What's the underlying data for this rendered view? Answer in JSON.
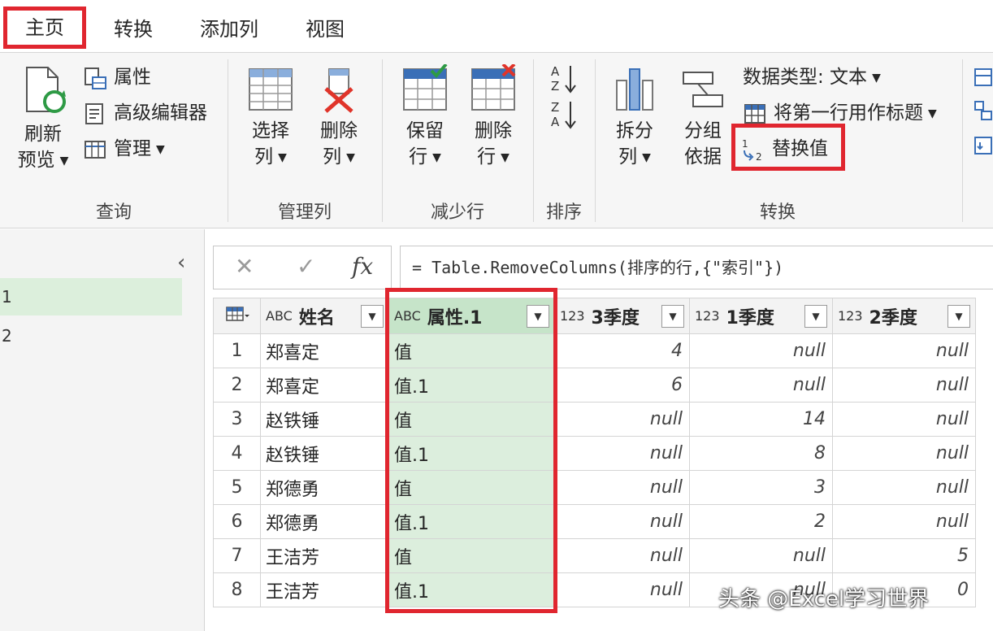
{
  "tabs": [
    "主页",
    "转换",
    "添加列",
    "视图"
  ],
  "ribbon": {
    "query": {
      "label": "查询",
      "refresh": [
        "刷新",
        "预览"
      ],
      "properties": "属性",
      "advanced_editor": "高级编辑器",
      "manage": "管理"
    },
    "manage_columns": {
      "label": "管理列",
      "choose": [
        "选择",
        "列"
      ],
      "remove": [
        "删除",
        "列"
      ]
    },
    "reduce_rows": {
      "label": "减少行",
      "keep": [
        "保留",
        "行"
      ],
      "remove": [
        "删除",
        "行"
      ]
    },
    "sort": {
      "label": "排序"
    },
    "transform": {
      "label": "转换",
      "split": [
        "拆分",
        "列"
      ],
      "group": [
        "分组",
        "依据"
      ],
      "data_type": "数据类型: 文本",
      "first_row_header": "将第一行用作标题",
      "replace_values": "替换值"
    }
  },
  "queries": [
    "1",
    "2"
  ],
  "formula": "= Table.RemoveColumns(排序的行,{\"索引\"})",
  "grid": {
    "columns": [
      {
        "type": "ABC",
        "name": "姓名"
      },
      {
        "type": "ABC",
        "name": "属性.1"
      },
      {
        "type": "123",
        "name": "3季度"
      },
      {
        "type": "123",
        "name": "1季度"
      },
      {
        "type": "123",
        "name": "2季度"
      }
    ],
    "rows": [
      [
        "1",
        "郑喜定",
        "值",
        "4",
        "null",
        "null"
      ],
      [
        "2",
        "郑喜定",
        "值.1",
        "6",
        "null",
        "null"
      ],
      [
        "3",
        "赵铁锤",
        "值",
        "null",
        "14",
        "null"
      ],
      [
        "4",
        "赵铁锤",
        "值.1",
        "null",
        "8",
        "null"
      ],
      [
        "5",
        "郑德勇",
        "值",
        "null",
        "3",
        "null"
      ],
      [
        "6",
        "郑德勇",
        "值.1",
        "null",
        "2",
        "null"
      ],
      [
        "7",
        "王洁芳",
        "值",
        "null",
        "null",
        "5"
      ],
      [
        "8",
        "王洁芳",
        "值.1",
        "null",
        "null",
        "0"
      ]
    ]
  },
  "watermark": "头条 @Excel学习世界",
  "colors": {
    "highlight_box": "#e0262f",
    "selected_column": "#dceedd"
  }
}
